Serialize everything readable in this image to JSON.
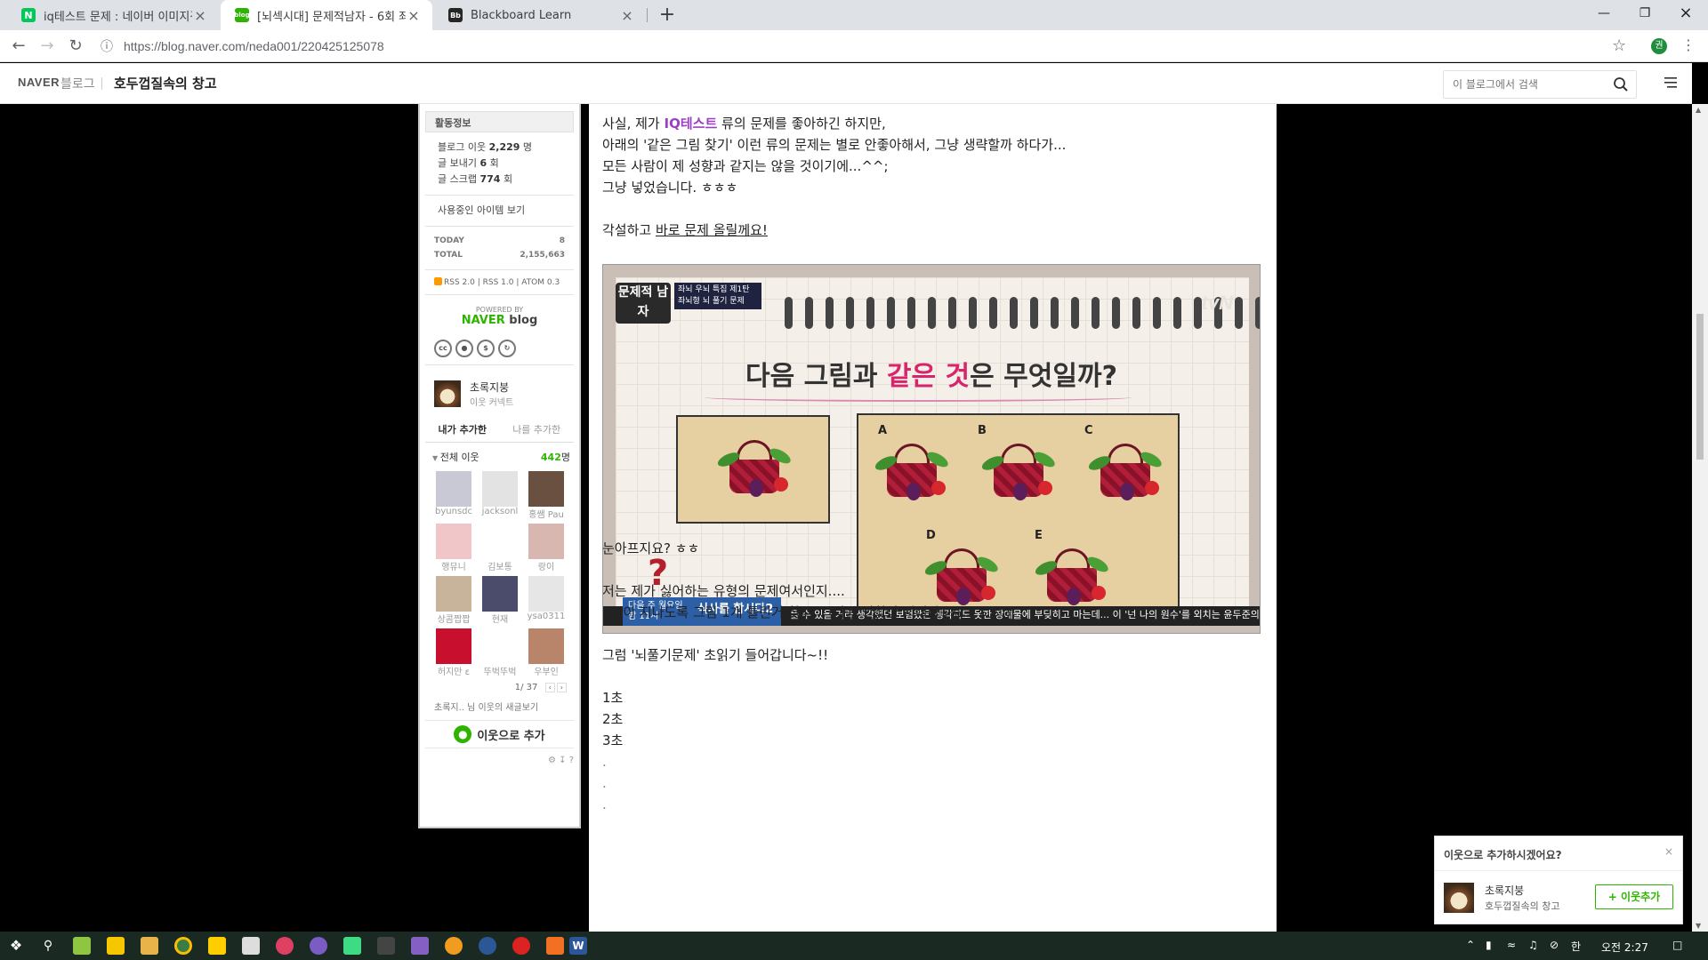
{
  "browser": {
    "tabs": [
      {
        "title": "iq테스트 문제 : 네이버 이미지검",
        "favicon": "N",
        "color": "#03c75a"
      },
      {
        "title": "[뇌섹시대] 문제적남자 - 6회 좌뇌",
        "favicon": "blog",
        "color": "#2db400"
      },
      {
        "title": "Blackboard Learn",
        "favicon": "Bb",
        "color": "#262626"
      }
    ],
    "url": "https://blog.naver.com/neda001/220425125078",
    "profile_initial": "권"
  },
  "blog_header": {
    "naver": "NAVER",
    "blog": "블로그",
    "title": "호두껍질속의 창고",
    "search_placeholder": "이 블로그에서 검색"
  },
  "sidebar": {
    "activity_title": "활동정보",
    "neighbors_line": "블로그 이웃",
    "neighbors_count": "2,229",
    "neighbors_unit": "명",
    "sent_line": "글 보내기",
    "sent_count": "6",
    "sent_unit": "회",
    "scrap_line": "글 스크랩",
    "scrap_count": "774",
    "scrap_unit": "회",
    "items_link": "사용중인 아이템 보기",
    "today_label": "TODAY",
    "today_value": "8",
    "total_label": "TOTAL",
    "total_value": "2,155,663",
    "rss": "RSS 2.0 | RSS 1.0 | ATOM 0.3",
    "powered_by": "POWERED BY",
    "powered_naver": "NAVER",
    "powered_blog": "blog",
    "owner_name": "초록지붕",
    "owner_sub": "이웃 커넥트",
    "tab_mine": "내가 추가한",
    "tab_others": "나를 추가한",
    "all_neighbors": "전체 이웃",
    "all_count": "442",
    "all_unit": "명",
    "neighbors": [
      {
        "name": "byunsdc",
        "color": "#c9c9d6"
      },
      {
        "name": "jacksonl",
        "color": "#e3e3e3"
      },
      {
        "name": "홍쌤 Pau",
        "color": "#6a5040"
      },
      {
        "name": "행뮤니",
        "color": "#f0c6c9"
      },
      {
        "name": "김보통",
        "color": "#ffffff"
      },
      {
        "name": "랑이",
        "color": "#d8b7b0"
      },
      {
        "name": "상콤짭짭",
        "color": "#c8b49a"
      },
      {
        "name": "현재",
        "color": "#4b4b6b"
      },
      {
        "name": "ysa0311",
        "color": "#e6e6e6"
      },
      {
        "name": "허지만 ε",
        "color": "#c8102e"
      },
      {
        "name": "뚜벅뚜벅",
        "color": "#ffffff"
      },
      {
        "name": "우부인",
        "color": "#b8846a"
      }
    ],
    "page": "1/ 37",
    "new_posts": "초록지.. 님 이웃의 새글보기",
    "add_button": "이웃으로 추가"
  },
  "post": {
    "line1_a": "사실, 제가",
    "line1_hl": "IQ테스트",
    "line1_b": "류의 문제를 좋아하긴 하지만,",
    "line2": "아래의 '같은 그림 찾기' 이런 류의 문제는 별로 안좋아해서, 그냥 생략할까 하다가...",
    "line3": "모든 사람이 제 성향과 같지는 않을 것이기에...^^;",
    "line4": "그냥 넣었습니다. ㅎㅎㅎ",
    "line5_a": "각설하고",
    "line5_link": "바로 문제 올릴께요!",
    "line6": "눈아프지요? ㅎㅎ",
    "line7": "저는 제가 싫어하는 유형의 문제여서인지....",
    "line8": "3분이 지나도록 그림 1개 틀린거 찾고, 그다음 안찾아 지더라구요...ㅎㅎㅎ",
    "line9": "그럼 '뇌풀기문제' 초읽기 들어갑니다~!!",
    "count1": "1초",
    "count2": "2초",
    "count3": "3초",
    "dot": "."
  },
  "figure": {
    "show_logo": "문제적 남자",
    "tag1": "좌뇌 우뇌 특집 제1탄",
    "tag2": "좌뇌형 뇌 풀기 문제",
    "channel": "tvN",
    "question_a": "다음 그림과",
    "question_red": "같은 것",
    "question_b": "은 무엇일까?",
    "options": [
      "A",
      "B",
      "C",
      "D",
      "E"
    ],
    "badge_line1": "다음 주 월요일",
    "badge_line2": "밤 11시",
    "badge_title": "식사를 합시다2",
    "caption": "를 수 있을 거라 생각했던 보험왔은 생각지도 못한 장애물에 부딪히고 마는데... 이 '넌 나의 원수'를 외치는 윤두준의"
  },
  "popup": {
    "title": "이웃으로 추가하시겠어요?",
    "name": "초록지붕",
    "blog": "호두껍질속의 창고",
    "button": "+ 이웃추가"
  },
  "taskbar": {
    "clock": "오전 2:27",
    "ime": "한"
  }
}
